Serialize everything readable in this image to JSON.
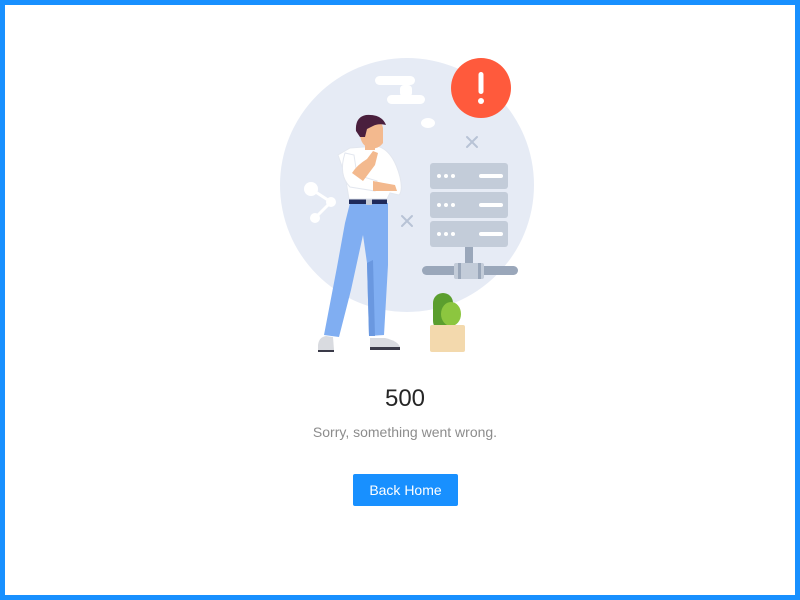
{
  "result": {
    "status_code": "500",
    "message": "Sorry, something went wrong.",
    "back_button_label": "Back Home"
  },
  "illustration": {
    "alert_glyph": "!",
    "icons": [
      "alert-icon",
      "server-icon",
      "share-icon",
      "plant-icon",
      "person-thinking"
    ]
  },
  "colors": {
    "frame_border": "#1890ff",
    "primary_button": "#1890ff",
    "alert": "#ff5a3c",
    "background_circle": "#e6ebf5"
  }
}
